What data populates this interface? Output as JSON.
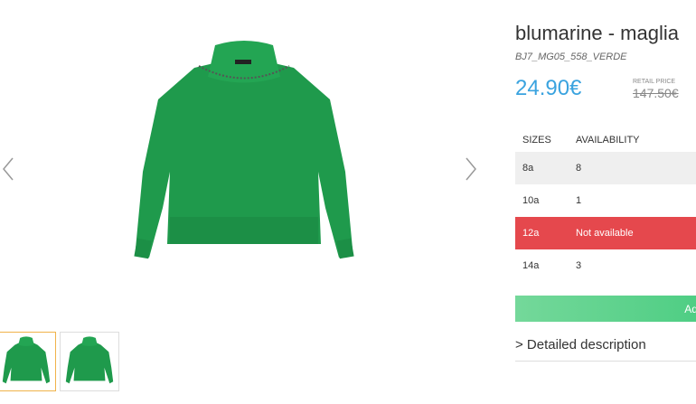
{
  "product": {
    "title": "blumarine - maglia",
    "sku": "BJ7_MG05_558_VERDE",
    "price": "24.90€",
    "retail_label": "RETAIL PRICE",
    "retail_price": "147.50€"
  },
  "sizes": {
    "header_size": "SIZES",
    "header_availability": "AVAILABILITY",
    "rows": [
      {
        "size": "8a",
        "availability": "8"
      },
      {
        "size": "10a",
        "availability": "1"
      },
      {
        "size": "12a",
        "availability": "Not available"
      },
      {
        "size": "14a",
        "availability": "3"
      }
    ]
  },
  "actions": {
    "add_to_cart": "Add to",
    "detailed_description": "> Detailed description"
  },
  "colors": {
    "sweater": "#1f9a4c",
    "price": "#3aa3df",
    "not_available": "#e5484d",
    "add_button": "#5ccf8a"
  },
  "icons": {
    "prev": "chevron-left-icon",
    "next": "chevron-right-icon"
  }
}
